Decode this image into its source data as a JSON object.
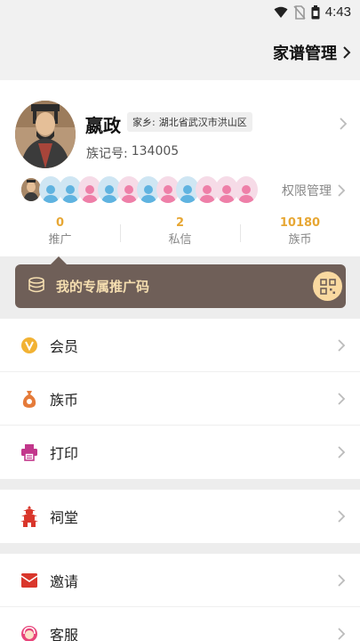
{
  "status": {
    "time": "4:43"
  },
  "header": {
    "title": "家谱管理"
  },
  "profile": {
    "name": "嬴政",
    "hometown_label": "家乡:",
    "hometown": "湖北省武汉市洪山区",
    "clan_id_label": "族记号:",
    "clan_id": "134005",
    "permission_label": "权限管理",
    "members": [
      "photo",
      "male",
      "male",
      "female",
      "male",
      "female",
      "male",
      "female",
      "male",
      "female",
      "female",
      "female"
    ]
  },
  "stats": [
    {
      "value": "0",
      "label": "推广"
    },
    {
      "value": "2",
      "label": "私信"
    },
    {
      "value": "10180",
      "label": "族币"
    }
  ],
  "promo": {
    "label": "我的专属推广码"
  },
  "menu": {
    "group1": [
      {
        "label": "会员",
        "icon": "vip-icon"
      },
      {
        "label": "族币",
        "icon": "money-bag-icon"
      },
      {
        "label": "打印",
        "icon": "printer-icon"
      }
    ],
    "group2": [
      {
        "label": "祠堂",
        "icon": "pagoda-icon"
      }
    ],
    "group3": [
      {
        "label": "邀请",
        "icon": "envelope-icon"
      },
      {
        "label": "客服",
        "icon": "customer-service-icon"
      }
    ]
  },
  "colors": {
    "accent": "#e7a734",
    "promo_bg": "#6f5f58",
    "promo_text": "#f5deb0"
  }
}
